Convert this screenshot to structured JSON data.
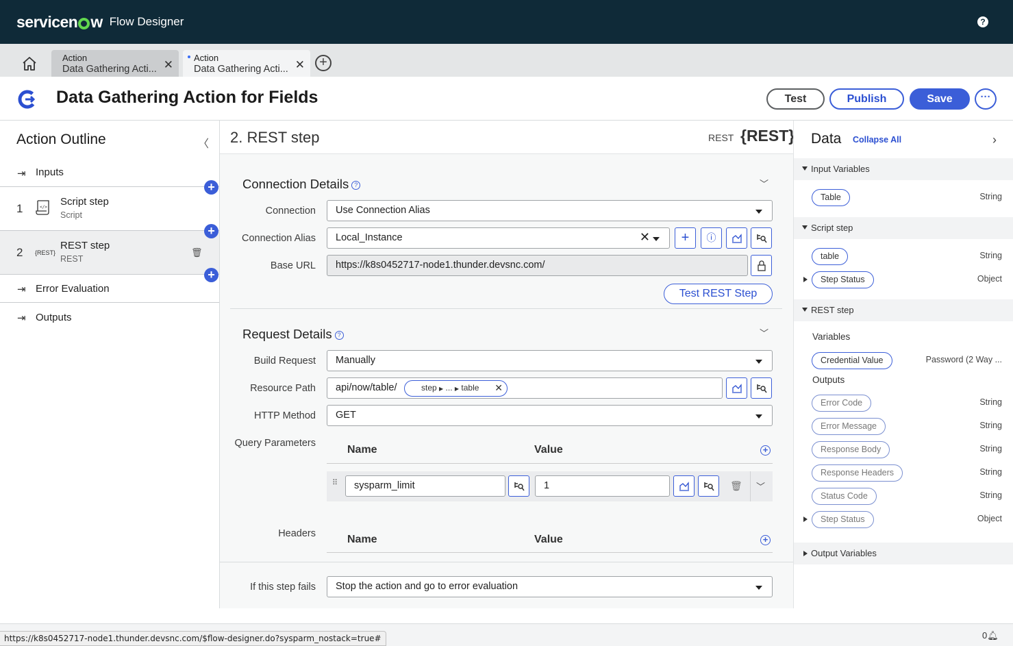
{
  "app": {
    "brand": "servicenow",
    "product": "Flow Designer"
  },
  "tabs": [
    {
      "type": "Action",
      "name": "Data Gathering Acti..."
    },
    {
      "type": "Action",
      "name": "Data Gathering Acti..."
    }
  ],
  "title": "Data Gathering Action for Fields",
  "toolbar": {
    "test": "Test",
    "publish": "Publish",
    "save": "Save",
    "more": "···"
  },
  "outline": {
    "title": "Action Outline",
    "inputs": "Inputs",
    "steps": [
      {
        "num": "1",
        "name": "Script step",
        "type": "Script"
      },
      {
        "num": "2",
        "name": "REST step",
        "type": "REST",
        "icon_text": "{REST}"
      }
    ],
    "error_evaluation": "Error Evaluation",
    "outputs": "Outputs"
  },
  "step": {
    "title": "2.  REST step",
    "type_label": "REST",
    "badge": "{REST}",
    "connection_details": {
      "title": "Connection Details",
      "connection_label": "Connection",
      "connection_value": "Use Connection Alias",
      "alias_label": "Connection Alias",
      "alias_value": "Local_Instance",
      "base_url_label": "Base URL",
      "base_url_value": "https://k8s0452717-node1.thunder.devsnc.com/",
      "test_button": "Test REST Step"
    },
    "request_details": {
      "title": "Request Details",
      "build_label": "Build Request",
      "build_value": "Manually",
      "resource_label": "Resource Path",
      "resource_prefix": "api/now/table/",
      "resource_pill": {
        "a": "step",
        "b": "...",
        "c": "table"
      },
      "method_label": "HTTP Method",
      "method_value": "GET",
      "query_label": "Query Parameters",
      "col_name": "Name",
      "col_value": "Value",
      "query_rows": [
        {
          "name": "sysparm_limit",
          "value": "1"
        }
      ],
      "headers_label": "Headers"
    },
    "fail_label": "If this step fails",
    "fail_value": "Stop the action and go to error evaluation"
  },
  "data_panel": {
    "title": "Data",
    "collapse_all": "Collapse All",
    "input_variables": {
      "title": "Input Variables",
      "items": [
        {
          "name": "Table",
          "type": "String"
        }
      ]
    },
    "script_step": {
      "title": "Script step",
      "items": [
        {
          "name": "table",
          "type": "String"
        },
        {
          "name": "Step Status",
          "type": "Object"
        }
      ]
    },
    "rest_step": {
      "title": "REST step",
      "variables_label": "Variables",
      "variables": [
        {
          "name": "Credential Value",
          "type": "Password (2 Way ..."
        }
      ],
      "outputs_label": "Outputs",
      "outputs": [
        {
          "name": "Error Code",
          "type": "String"
        },
        {
          "name": "Error Message",
          "type": "String"
        },
        {
          "name": "Response Body",
          "type": "String"
        },
        {
          "name": "Response Headers",
          "type": "String"
        },
        {
          "name": "Status Code",
          "type": "String"
        },
        {
          "name": "Step Status",
          "type": "Object"
        }
      ]
    },
    "output_variables": {
      "title": "Output Variables"
    }
  },
  "status_bar": {
    "url": "https://k8s0452717-node1.thunder.devsnc.com/$flow-designer.do?sysparm_nostack=true#",
    "notifications": "0"
  },
  "colors": {
    "nav": "#0f2a38",
    "accent": "#3b5ed8",
    "logo_green": "#62d84e"
  }
}
